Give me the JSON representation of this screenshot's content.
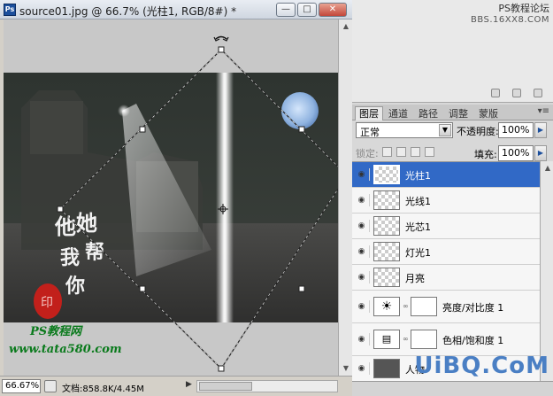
{
  "document": {
    "title": "source01.jpg @ 66.7% (光柱1, RGB/8#) *",
    "ps_logo": "Ps",
    "window_buttons": {
      "minimize": "—",
      "maximize": "□",
      "close": "✕"
    },
    "zoom": "66.67%",
    "doc_info": "文档:858.8K/4.45M",
    "canvas_text": {
      "calligraphy": [
        "他",
        "她",
        "我",
        "帮",
        "你"
      ],
      "seal": "印",
      "site_name": "PS教程网",
      "site_url": "www.tata580.com"
    }
  },
  "right_top": {
    "watermark_line1": "PS教程论坛",
    "watermark_line2": "BBS.16XX8.COM"
  },
  "panel": {
    "tabs": [
      "图层",
      "通道",
      "路径",
      "调整",
      "蒙版"
    ],
    "active_tab": "图层",
    "blend_mode": "正常",
    "opacity_label": "不透明度:",
    "opacity_value": "100%",
    "lock_label": "锁定:",
    "fill_label": "填充:",
    "fill_value": "100%"
  },
  "layers": [
    {
      "name": "光柱1",
      "selected": true
    },
    {
      "name": "光线1",
      "selected": false
    },
    {
      "name": "光芯1",
      "selected": false
    },
    {
      "name": "灯光1",
      "selected": false
    },
    {
      "name": "月亮",
      "selected": false
    },
    {
      "name": "亮度/对比度 1",
      "selected": false
    },
    {
      "name": "色相/饱和度 1",
      "selected": false
    },
    {
      "name": "人物",
      "selected": false
    }
  ],
  "watermark_bottom": "UiBQ.CoM",
  "colors": {
    "selection": "#3169c6",
    "accent": "#1c4f9c"
  }
}
